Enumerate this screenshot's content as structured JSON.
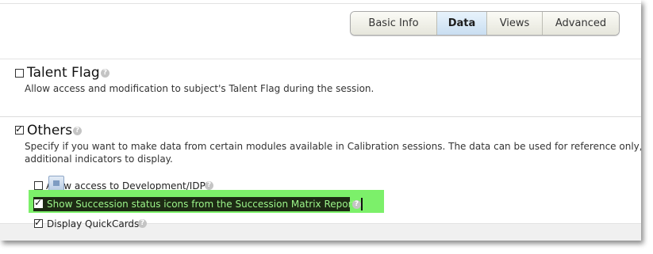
{
  "tabs": {
    "basic_info": "Basic Info",
    "data": "Data",
    "views": "Views",
    "advanced": "Advanced",
    "active": "Data"
  },
  "talent_flag": {
    "title": "Talent Flag",
    "checked": false,
    "description": "Allow access and modification to subject's Talent Flag during the session."
  },
  "others": {
    "title": "Others",
    "checked": true,
    "description_line1": "Specify if you want to make data from certain modules available in Calibration sessions. The data can be used for reference only, an",
    "description_line2": "additional indicators to display.",
    "options": [
      {
        "label": "Allow access to Development/IDP",
        "checked": false
      },
      {
        "label": "Show Succession status icons from the Succession Matrix Report",
        "checked": true,
        "highlighted": true
      },
      {
        "label": "Display QuickCards",
        "checked": true
      }
    ]
  },
  "icons": {
    "help": "help-icon",
    "check": "check-icon"
  },
  "colors": {
    "highlight": "#7cf06a",
    "active_tab": "#c9def1"
  }
}
